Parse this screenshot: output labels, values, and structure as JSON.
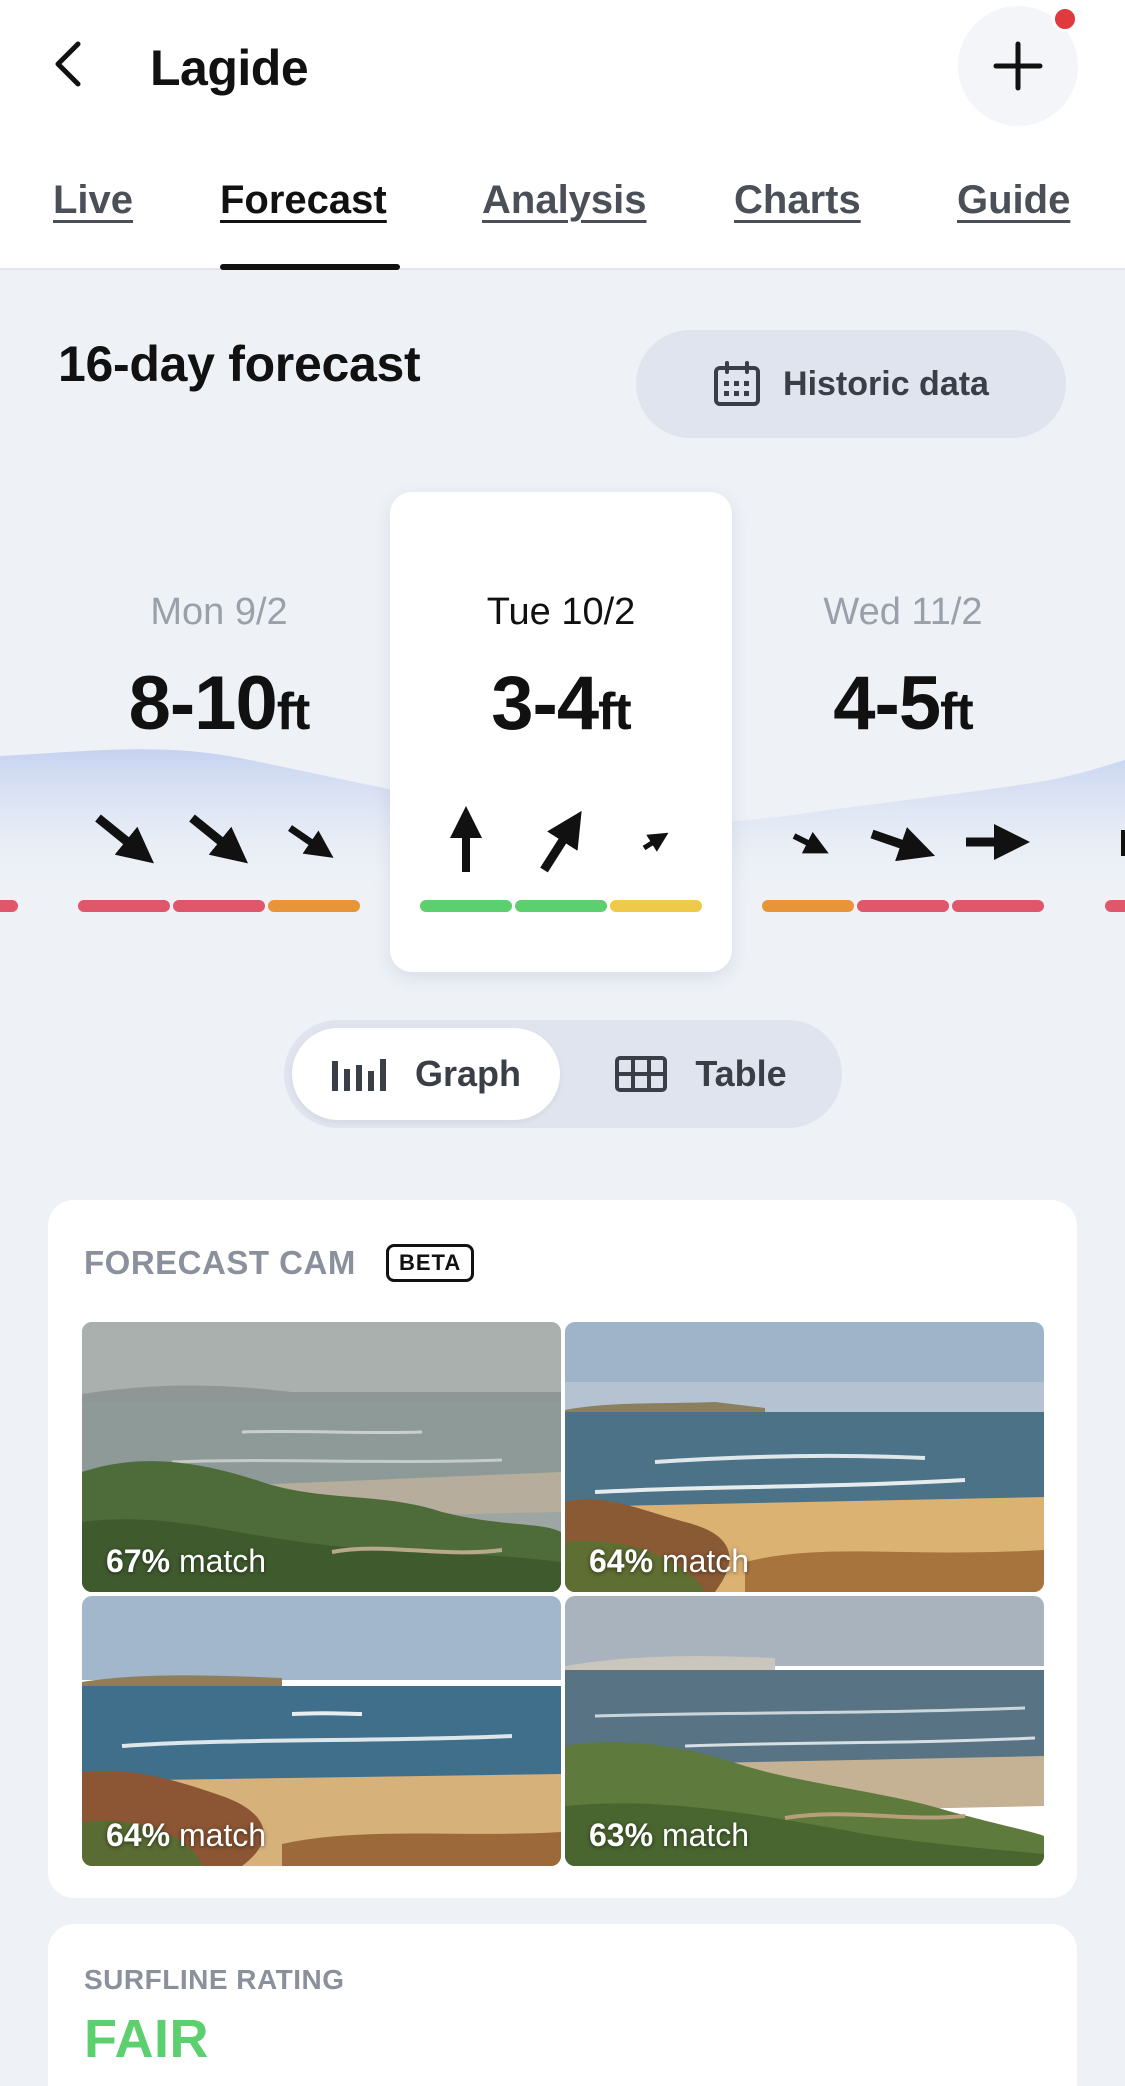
{
  "header": {
    "title": "Lagide",
    "add_icon": "plus-icon",
    "back_icon": "chevron-left-icon",
    "notification_color": "#e0393e"
  },
  "tabs": [
    {
      "label": "Live",
      "active": false
    },
    {
      "label": "Forecast",
      "active": true
    },
    {
      "label": "Analysis",
      "active": false
    },
    {
      "label": "Charts",
      "active": false
    },
    {
      "label": "Guide",
      "active": false
    }
  ],
  "forecast": {
    "title": "16-day forecast",
    "historic_label": "Historic data",
    "historic_icon": "calendar-icon"
  },
  "days": [
    {
      "label": "Mon 9/2",
      "height": "8-10",
      "unit": "ft",
      "active": false,
      "ratings": [
        "#e0566b",
        "#e0566b",
        "#e8953a"
      ]
    },
    {
      "label": "Tue 10/2",
      "height": "3-4",
      "unit": "ft",
      "active": true,
      "ratings": [
        "#5ccf6e",
        "#5ccf6e",
        "#efc94a"
      ]
    },
    {
      "label": "Wed 11/2",
      "height": "4-5",
      "unit": "ft",
      "active": false,
      "ratings": [
        "#e8953a",
        "#e0566b",
        "#e0566b"
      ]
    }
  ],
  "view_toggle": {
    "graph_label": "Graph",
    "graph_icon": "bar-chart-icon",
    "table_label": "Table",
    "table_icon": "grid-icon",
    "selected": "Graph"
  },
  "forecast_cam": {
    "heading": "FORECAST CAM",
    "badge": "BETA",
    "images": [
      {
        "pct": "67%",
        "suffix": "match"
      },
      {
        "pct": "64%",
        "suffix": "match"
      },
      {
        "pct": "64%",
        "suffix": "match"
      },
      {
        "pct": "63%",
        "suffix": "match"
      }
    ]
  },
  "surfline_rating": {
    "heading": "SURFLINE RATING",
    "value": "FAIR",
    "color": "#5ccf6e"
  }
}
